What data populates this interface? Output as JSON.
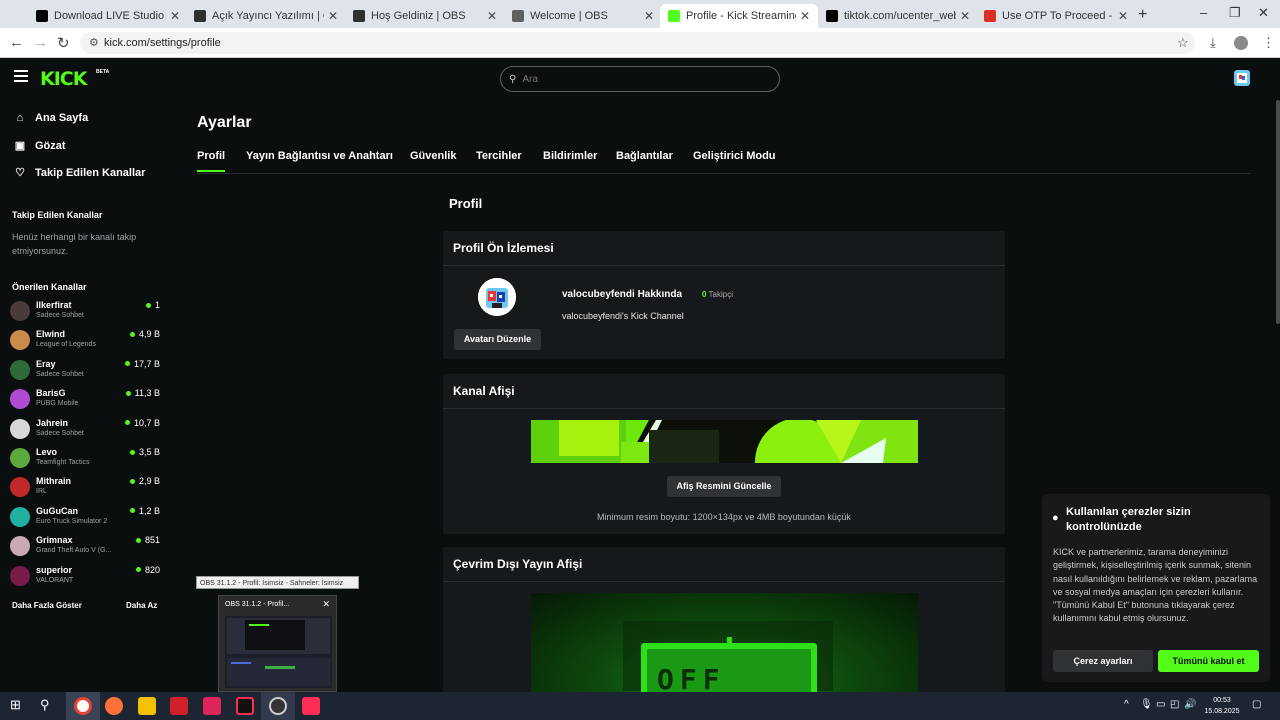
{
  "browser": {
    "tabs": [
      {
        "title": "Download LIVE Studio | TikTok",
        "color": "#000000"
      },
      {
        "title": "Açık Yayıncı Yazılımı | OBS",
        "color": "#303030"
      },
      {
        "title": "Hoş Geldiniz | OBS",
        "color": "#303030"
      },
      {
        "title": "Welcome | OBS",
        "color": "#606060"
      },
      {
        "title": "Profile - Kick Streaming",
        "color": "#53fc18"
      },
      {
        "title": "tiktok.com/ucenter_web/onetap",
        "color": "#000000"
      },
      {
        "title": "Use OTP To Proceed - beratozt",
        "color": "#d93025"
      }
    ],
    "url": "kick.com/settings/profile"
  },
  "header": {
    "logo": "KICK",
    "beta": "BETA",
    "search_placeholder": "Ara"
  },
  "sidebar": {
    "nav": [
      {
        "label": "Ana Sayfa",
        "icon": "home-icon"
      },
      {
        "label": "Gözat",
        "icon": "browse-icon"
      },
      {
        "label": "Takip Edilen Kanallar",
        "icon": "heart-icon"
      }
    ],
    "following_title": "Takip Edilen Kanallar",
    "following_empty": "Henüz herhangi bir kanalı takip etmiyorsunuz.",
    "recommended_title": "Önerilen Kanallar",
    "channels": [
      {
        "name": "Ilkerfirat",
        "category": "Sadece Sohbet",
        "viewers": "1",
        "color": "#4a3b3a"
      },
      {
        "name": "Elwind",
        "category": "League of Legends",
        "viewers": "4,9 B",
        "color": "#c98a4a"
      },
      {
        "name": "Eray",
        "category": "Sadece Sohbet",
        "viewers": "17,7 B",
        "color": "#2f6b3a"
      },
      {
        "name": "BarisG",
        "category": "PUBG Mobile",
        "viewers": "11,3 B",
        "color": "#b04ad0"
      },
      {
        "name": "Jahrein",
        "category": "Sadece Sohbet",
        "viewers": "10,7 B",
        "color": "#d8d8d8"
      },
      {
        "name": "Levo",
        "category": "Teamfight Tactics",
        "viewers": "3,5 B",
        "color": "#5ca83a"
      },
      {
        "name": "Mithrain",
        "category": "IRL",
        "viewers": "2,9 B",
        "color": "#c0282a"
      },
      {
        "name": "GuGuCan",
        "category": "Euro Truck Simulator 2",
        "viewers": "1,2 B",
        "color": "#1fb0a0"
      },
      {
        "name": "Grimnax",
        "category": "Grand Theft Auto V (G...",
        "viewers": "851",
        "color": "#c9a8b8"
      },
      {
        "name": "superior",
        "category": "VALORANT",
        "viewers": "820",
        "color": "#7a1a4a"
      }
    ],
    "show_more": "Daha Fazla Göster",
    "show_less": "Daha Az"
  },
  "settings": {
    "title": "Ayarlar",
    "tabs": [
      "Profil",
      "Yayın Bağlantısı ve Anahtarı",
      "Güvenlik",
      "Tercihler",
      "Bildirimler",
      "Bağlantılar",
      "Geliştirici Modu"
    ],
    "section_title": "Profil",
    "preview": {
      "title": "Profil Ön İzlemesi",
      "about": "valocubeyfendi Hakkında",
      "followers_count": "0",
      "followers_label": "Takipçi",
      "description": "valocubeyfendi's Kick Channel",
      "edit_avatar": "Avatarı Düzenle"
    },
    "banner": {
      "title": "Kanal Afişi",
      "update_button": "Afiş Resmini Güncelle",
      "hint": "Minimum resim boyutu: 1200×134px ve 4MB boyutundan küçük"
    },
    "offline": {
      "title": "Çevrim Dışı Yayın Afişi",
      "sign": "OFF"
    }
  },
  "cookie": {
    "title": "Kullanılan çerezler sizin kontrolünüzde",
    "body": "KICK ve partnerlerimiz, tarama deneyiminizi geliştirmek, kişiselleştirilmiş içerik sunmak, sitenin nasıl kullanıldığını belirlemek ve reklam, pazarlama ve sosyal medya amaçları için çerezleri kullanır. \"Tümünü Kabul Et\" butonuna tıklayarak çerez kullanımını kabul etmiş olursunuz.",
    "settings_button": "Çerez ayarları",
    "accept_button": "Tümünü kabul et"
  },
  "obs_preview": {
    "label": "OBS 31.1.2 - Profil: İsimsiz - Sahneler: İsimsiz",
    "window_title": "OBS 31.1.2 - Profil..."
  },
  "taskbar": {
    "time": "00:53",
    "date": "15.08.2025"
  },
  "colors": {
    "accent": "#53fc18",
    "background": "#0b0e0f",
    "card": "#16191b"
  }
}
